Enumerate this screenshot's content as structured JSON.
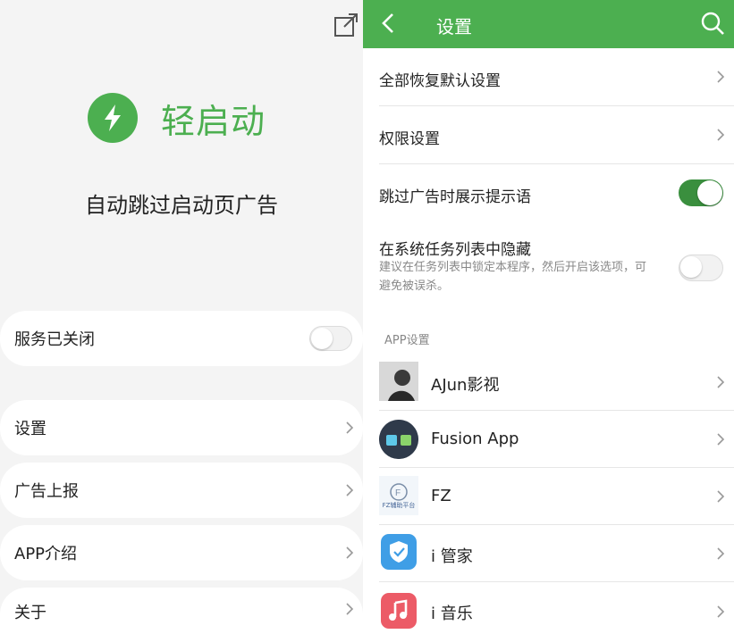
{
  "left": {
    "brand_name": "轻启动",
    "tagline": "自动跳过启动页广告",
    "service_label": "服务已关闭",
    "menu": [
      {
        "label": "设置"
      },
      {
        "label": "广告上报"
      },
      {
        "label": "APP介绍"
      },
      {
        "label": "关于"
      }
    ]
  },
  "right": {
    "title": "设置",
    "settings": [
      {
        "label": "全部恢复默认设置"
      },
      {
        "label": "权限设置"
      },
      {
        "label": "跳过广告时展示提示语",
        "toggle": "on"
      },
      {
        "label": "在系统任务列表中隐藏",
        "sub": "建议在任务列表中锁定本程序，然后开启该选项，可避免被误杀。",
        "toggle": "off"
      }
    ],
    "section_label": "APP设置",
    "apps": [
      {
        "name": "AJun影视",
        "icon": "ajun-app-icon"
      },
      {
        "name": "Fusion App",
        "icon": "fusion-app-icon"
      },
      {
        "name": "FZ",
        "icon": "fz-app-icon",
        "icon_text": "FZ辅助平台"
      },
      {
        "name": "i 管家",
        "icon": "shield-app-icon"
      },
      {
        "name": "i 音乐",
        "icon": "music-app-icon"
      }
    ]
  },
  "colors": {
    "accent": "#4caf50",
    "toggle_on": "#3a8f3e"
  }
}
